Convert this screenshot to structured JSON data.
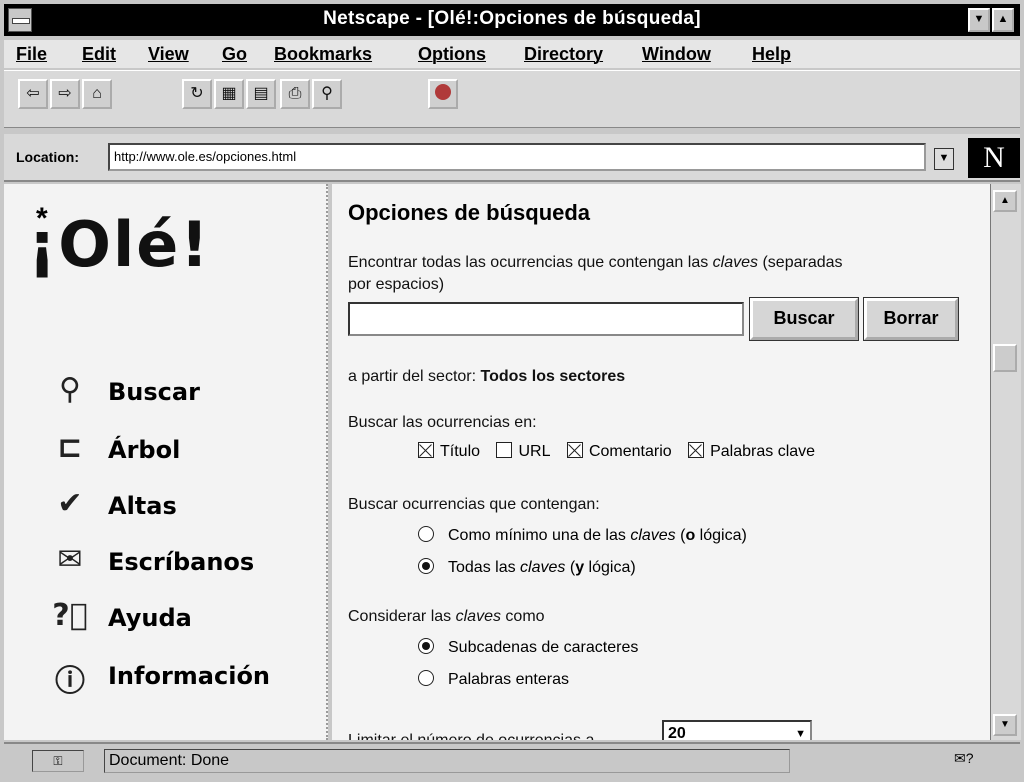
{
  "window": {
    "title": "Netscape - [Olé!:Opciones de búsqueda]"
  },
  "menu": [
    "File",
    "Edit",
    "View",
    "Go",
    "Bookmarks",
    "Options",
    "Directory",
    "Window",
    "Help"
  ],
  "toolbar": {
    "icons": [
      "back-icon",
      "forward-icon",
      "home-icon",
      "reload-icon",
      "images-icon",
      "open-icon",
      "print-icon",
      "find-icon",
      "stop-icon"
    ]
  },
  "location": {
    "label": "Location:",
    "url": "http://www.ole.es/opciones.html"
  },
  "sidebar": {
    "logo": "¡Olé!",
    "items": [
      {
        "label": "Buscar",
        "icon": "magnifier-icon"
      },
      {
        "label": "Árbol",
        "icon": "tree-icon"
      },
      {
        "label": "Altas",
        "icon": "checkmark-icon"
      },
      {
        "label": "Escríbanos",
        "icon": "envelope-icon"
      },
      {
        "label": "Ayuda",
        "icon": "help-icon"
      },
      {
        "label": "Información",
        "icon": "info-icon"
      }
    ]
  },
  "main": {
    "title": "Opciones de búsqueda",
    "intro_a": "Encontrar todas las ocurrencias que contengan las ",
    "intro_claves": "claves",
    "intro_b": " (separadas",
    "intro_line2": "por espacios)",
    "search_value": "",
    "buscar_label": "Buscar",
    "borrar_label": "Borrar",
    "sector_prefix": "a partir del sector: ",
    "sector_value": "Todos los sectores",
    "fields_label": "Buscar las ocurrencias en:",
    "fields": [
      {
        "label": "Título",
        "checked": true
      },
      {
        "label": "URL",
        "checked": false
      },
      {
        "label": "Comentario",
        "checked": true
      },
      {
        "label": "Palabras clave",
        "checked": true
      }
    ],
    "logic_label": "Buscar ocurrencias que contengan:",
    "logic_opt1_a": "Como mínimo una de las ",
    "logic_opt1_claves": "claves",
    "logic_opt1_b": " (",
    "logic_opt1_bold": "o",
    "logic_opt1_c": " lógica)",
    "logic_opt2_a": "Todas las ",
    "logic_opt2_claves": "claves",
    "logic_opt2_b": " (",
    "logic_opt2_bold": "y",
    "logic_opt2_c": " lógica)",
    "logic_selected": 2,
    "consider_a": "Considerar las ",
    "consider_claves": "claves",
    "consider_b": " como",
    "consider_opt1": "Subcadenas de caracteres",
    "consider_opt2": "Palabras enteras",
    "consider_selected": 1,
    "limit_partial": "Limitar el número de ocurrencias a",
    "limit_value": "20"
  },
  "status": {
    "message": "Document: Done"
  }
}
